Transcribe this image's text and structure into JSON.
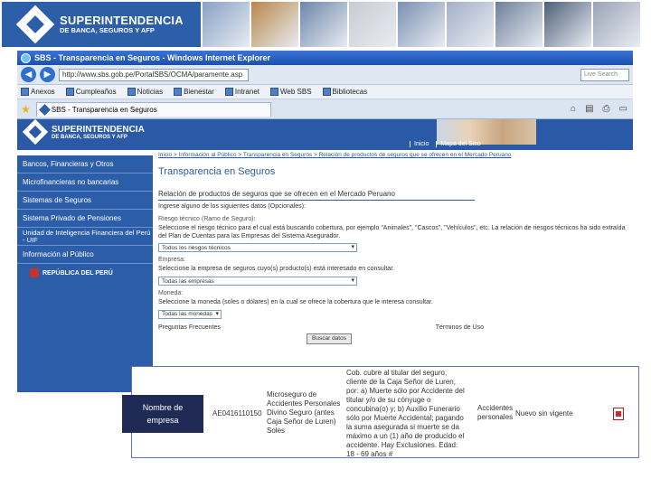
{
  "banner": {
    "logo_line1": "SUPERINTENDENCIA",
    "logo_line2": "DE BANCA, SEGUROS Y AFP",
    "photo_colors": [
      "#8aa0c6",
      "#b9874a",
      "#6d86a9",
      "#c9cbd2",
      "#7b8fb2",
      "#a3b0c8",
      "#6e7f9a",
      "#4e5f7a",
      "#9aa4b6"
    ]
  },
  "browser": {
    "window_title": "SBS - Transparencia en Seguros - Windows Internet Explorer",
    "url": "http://www.sbs.gob.pe/PortalSBS/OCMA/paramente.asp",
    "search_placeholder": "Live Search",
    "links": [
      "Anexos",
      "Cumpleaños",
      "Noticias",
      "Bienestar",
      "Intranet",
      "Web SBS",
      "Bibliotecas"
    ],
    "tab_label": "SBS - Transparencia en Seguros"
  },
  "site": {
    "logo_line1": "SUPERINTENDENCIA",
    "logo_line2": "DE BANCA, SEGUROS Y AFP",
    "login_links": [
      "Inicio",
      "Mapa del Sitio"
    ],
    "sidebar": [
      "Bancos, Financieras y Otros",
      "Microfinancieras no bancarias",
      "Sistemas de Seguros",
      "Sistema Privado de Pensiones",
      "Unidad de Inteligencia Financiera del Perú - UIF",
      "Información al Público"
    ],
    "peru_label": "REPÚBLICA DEL PERÚ"
  },
  "main": {
    "breadcrumb": "Inicio > Información al Público > Transparencia en Seguros > Relación de productos de seguros que se ofrecen en el Mercado Peruano",
    "title": "Transparencia en Seguros",
    "subtitle": "Relación de productos de seguros que se ofrecen en el Mercado Peruano",
    "intro": "Ingrese alguno de los siguientes datos (Opcionales):",
    "riesgo_label": "Riesgo técnico (Ramo de Seguro):",
    "riesgo_help": "Seleccione el riesgo técnico para el cual está buscando cobertura, por ejemplo \"Animales\", \"Cascos\", \"Vehículos\", etc. La relación de riesgos técnicos ha sido extraída del Plan de Cuentas para las Empresas del Sistema Asegurador.",
    "riesgo_select": "Todos los riesgos técnicos",
    "empresa_label": "Empresa:",
    "empresa_help": "Seleccione la empresa de seguros cuyo(s) producto(s) está interesado en consultar.",
    "empresa_select": "Todas las empresas",
    "moneda_label": "Moneda:",
    "moneda_help": "Seleccione la moneda (soles o dólares) en la cual se ofrece la cobertura que le interesa consultar.",
    "moneda_select": "Todas las monedas",
    "faq": "Preguntas Frecuentes",
    "terms": "Términos de Uso",
    "search_button": "Buscar datos"
  },
  "result": {
    "name_label_line1": "Nombre de",
    "name_label_line2": "empresa",
    "code": "AE0416110150",
    "product_lines": [
      "Microseguro de",
      "Accidentes Personales",
      "Divino Seguro (antes",
      "Caja Señor de Luren)",
      "Soles"
    ],
    "description_lines": [
      "Cob. cubre al titular del seguro,",
      "cliente de la Caja Señor de Luren,",
      "por: a) Muerte sólo por Accidente del",
      "titular y/o de su cónyuge o",
      "concubina(o) y; b) Auxilio Funerario",
      "sólo por Muerte Accidental; pagando",
      "la suma asegurada si muerte se da",
      "máximo a un (1) año de producido el",
      "accidente. Hay Exclusiones. Edad:",
      "18 - 69 años #"
    ],
    "ramo_lines": [
      "Accidentes",
      "personales"
    ],
    "status": "Nuevo sin vigente"
  }
}
